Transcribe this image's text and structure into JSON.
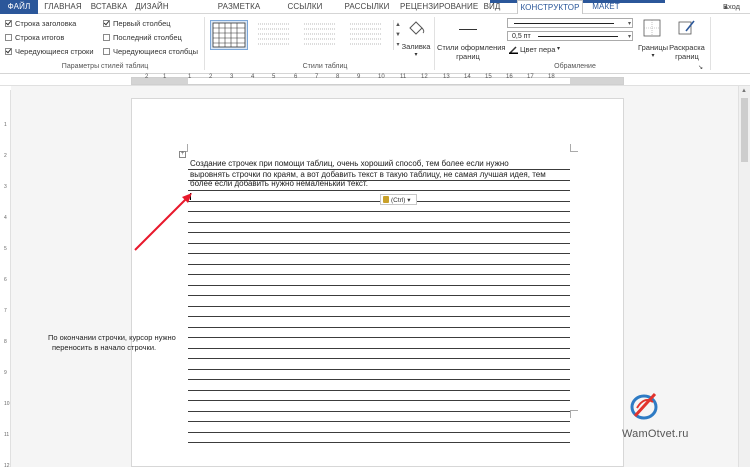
{
  "tabs": [
    {
      "label": "ФАЙЛ",
      "kind": "file"
    },
    {
      "label": "ГЛАВНАЯ",
      "kind": "normal"
    },
    {
      "label": "ВСТАВКА",
      "kind": "normal"
    },
    {
      "label": "ДИЗАЙН",
      "kind": "normal"
    },
    {
      "label": "РАЗМЕТКА СТРАНИЦЫ",
      "kind": "normal"
    },
    {
      "label": "ССЫЛКИ",
      "kind": "normal"
    },
    {
      "label": "РАССЫЛКИ",
      "kind": "normal"
    },
    {
      "label": "РЕЦЕНЗИРОВАНИЕ",
      "kind": "normal"
    },
    {
      "label": "ВИД",
      "kind": "normal"
    },
    {
      "label": "КОНСТРУКТОР",
      "kind": "active"
    },
    {
      "label": "МАКЕТ",
      "kind": "tool"
    }
  ],
  "account": {
    "login_label": "Вход"
  },
  "ribbon": {
    "style_options": {
      "group_label": "Параметры стилей таблиц",
      "checkboxes": [
        {
          "label": "Строка заголовка",
          "checked": true
        },
        {
          "label": "Строка итогов",
          "checked": false
        },
        {
          "label": "Чередующиеся строки",
          "checked": true
        },
        {
          "label": "Первый столбец",
          "checked": true
        },
        {
          "label": "Последний столбец",
          "checked": false
        },
        {
          "label": "Чередующиеся столбцы",
          "checked": false
        }
      ]
    },
    "table_styles": {
      "group_label": "Стили таблиц",
      "shading_label": "Заливка"
    },
    "borders": {
      "group_label": "Обрамление",
      "border_styles_label_1": "Стили оформления",
      "border_styles_label_2": "границ",
      "pen_weight": "0,5 пт",
      "pen_color_label": "Цвет пера",
      "borders_label": "Границы",
      "border_painter_label_1": "Раскраска",
      "border_painter_label_2": "границ"
    }
  },
  "ruler": {
    "numbers": [
      "2",
      "1",
      "1",
      "2",
      "3",
      "4",
      "5",
      "6",
      "7",
      "8",
      "9",
      "10",
      "11",
      "12",
      "13",
      "14",
      "15",
      "16",
      "17",
      "18"
    ]
  },
  "vruler": {
    "numbers": [
      "1",
      "2",
      "3",
      "4",
      "5",
      "6",
      "7",
      "8",
      "9",
      "10",
      "11",
      "12"
    ]
  },
  "document": {
    "text_lines": [
      "Создание строчек при помощи таблиц, очень хороший способ, тем более если нужно",
      "выровнять строчки по краям, а вот добавить текст в такую таблицу, не самая лучшая идея, тем",
      "более если добавить нужно немаленький текст."
    ],
    "paste_options_label": "(Ctrl)",
    "annotation_line1": "По окончании строчки, курсор нужно",
    "annotation_line2": "переносить в начало строчки.",
    "annotation_arrow_color": "#e8192c"
  },
  "watermark": {
    "text": "WamOtvet.ru"
  },
  "colors": {
    "accent": "#2b579a",
    "arrow": "#e8192c"
  }
}
